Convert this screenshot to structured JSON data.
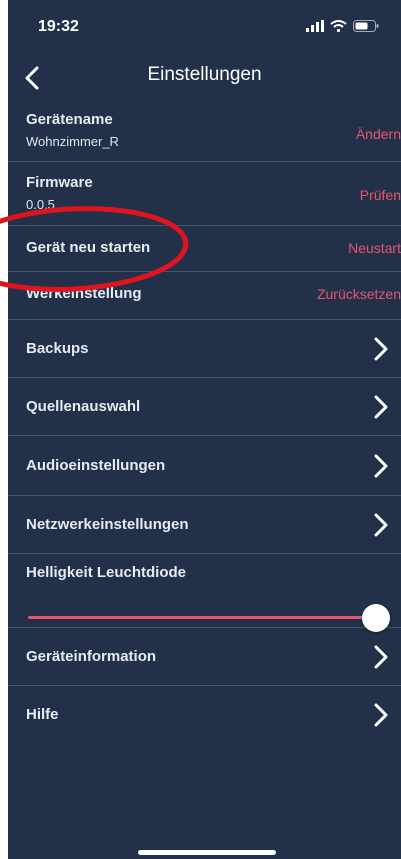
{
  "statusbar": {
    "time": "19:32"
  },
  "navbar": {
    "title": "Einstellungen"
  },
  "settings": {
    "device_name": {
      "label": "Gerätename",
      "value": "Wohnzimmer_R",
      "action": "Ändern"
    },
    "firmware": {
      "label": "Firmware",
      "value": "0.0.5",
      "action": "Prüfen"
    },
    "restart": {
      "label": "Gerät neu starten",
      "action": "Neustart"
    },
    "factory_reset": {
      "label": "Werkeinstellung",
      "action": "Zurücksetzen"
    },
    "backups": {
      "label": "Backups"
    },
    "source_selection": {
      "label": "Quellenauswahl"
    },
    "audio_settings": {
      "label": "Audioeinstellungen"
    },
    "network_settings": {
      "label": "Netzwerkeinstellungen"
    },
    "led_brightness": {
      "label": "Helligkeit Leuchtdiode",
      "value_fraction": 1.0
    },
    "device_info": {
      "label": "Geräteinformation"
    },
    "help": {
      "label": "Hilfe"
    }
  },
  "colors": {
    "background": "#22304a",
    "accent": "#e8556e",
    "divider": "#45536b",
    "annotation": "#e0141e"
  },
  "icons": [
    "signal-icon",
    "wifi-icon",
    "battery-icon",
    "back-chevron-icon",
    "chevron-right-icon"
  ]
}
